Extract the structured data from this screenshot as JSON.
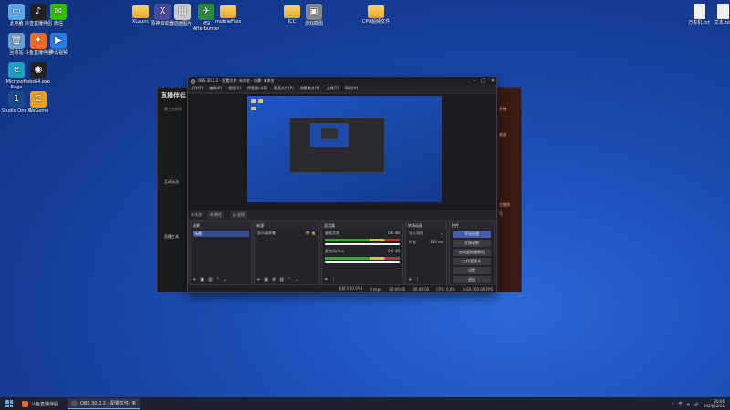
{
  "desktop_icons": [
    {
      "id": "i1",
      "label": "此电脑",
      "kind": "app",
      "color": "#5aa7e8",
      "glyph": "▭"
    },
    {
      "id": "i2",
      "label": "抖音直播伴侣",
      "kind": "app",
      "color": "#222",
      "glyph": "♪"
    },
    {
      "id": "i3",
      "label": "微信",
      "kind": "app",
      "color": "#2dc100",
      "glyph": "✉"
    },
    {
      "id": "i4",
      "label": "回收站",
      "kind": "app",
      "color": "#6aa0d0",
      "glyph": "🗑"
    },
    {
      "id": "i5",
      "label": "斗鱼直播伴侣",
      "kind": "app",
      "color": "#f26b1d",
      "glyph": "✦"
    },
    {
      "id": "i6",
      "label": "腾讯视频",
      "kind": "app",
      "color": "#2a7be4",
      "glyph": "▶"
    },
    {
      "id": "i7",
      "label": "Microsoft Edge",
      "kind": "app",
      "color": "#1fa0c4",
      "glyph": "e"
    },
    {
      "id": "i8",
      "label": "obs64.exe",
      "kind": "app",
      "color": "#222",
      "glyph": "◉"
    },
    {
      "id": "i9",
      "label": "Studio One 6",
      "kind": "app",
      "color": "#1a4a8a",
      "glyph": "1"
    },
    {
      "id": "i10",
      "label": "WeGame",
      "kind": "app",
      "color": "#e8a020",
      "glyph": "C"
    },
    {
      "id": "i11",
      "label": "XLaunc",
      "kind": "folder"
    },
    {
      "id": "i12",
      "label": "原神启动器",
      "kind": "app",
      "color": "#4a4a9a",
      "glyph": "X"
    },
    {
      "id": "i13",
      "label": "动画图片",
      "kind": "app",
      "color": "#ccc",
      "glyph": "▦"
    },
    {
      "id": "i14",
      "label": "MSI Afterburner",
      "kind": "app",
      "color": "#2a8a3a",
      "glyph": "✈"
    },
    {
      "id": "i15",
      "label": "mobileFiles",
      "kind": "folder"
    },
    {
      "id": "i16",
      "label": "ICC",
      "kind": "folder"
    },
    {
      "id": "i17",
      "label": "游戏截图",
      "kind": "app",
      "color": "#888",
      "glyph": "▣"
    },
    {
      "id": "i18",
      "label": "CPU超频文件",
      "kind": "folder"
    },
    {
      "id": "i19",
      "label": "万象机.txt",
      "kind": "file"
    },
    {
      "id": "i20",
      "label": "文本.txt",
      "kind": "file"
    }
  ],
  "bg_app": {
    "logo": "直播伴侣",
    "lines": [
      "第三方应用",
      "",
      "",
      "",
      "",
      "",
      ""
    ],
    "section1": "互动玩法",
    "section2": "直播工具",
    "right_labels": [
      "开播",
      "收益",
      "主播排",
      "号"
    ]
  },
  "obs": {
    "title": "OBS 30.2.2 - 配置文件: 未命名 - 场景: 未命名",
    "menus": [
      "文件(F)",
      "编辑(E)",
      "视图(V)",
      "停靠窗口(D)",
      "配置文件(P)",
      "场景集合(S)",
      "工具(T)",
      "帮助(H)"
    ],
    "toolbar": {
      "source": "未选源",
      "properties": "⚙ 属性",
      "filters": "▤ 滤镜"
    },
    "docks": {
      "scenes": {
        "title": "场景",
        "selected": "场景"
      },
      "sources": {
        "title": "来源",
        "item": "显示器采集"
      },
      "mixer": {
        "title": "混音器",
        "ch1": "桌面音频",
        "ch1_db": "0.0 dB",
        "ch2": "麦克风/Aux",
        "ch2_db": "0.0 dB"
      },
      "transitions": {
        "title": "转场动画",
        "type": "淡入淡出",
        "duration_label": "时长",
        "duration": "300 ms"
      },
      "controls": {
        "title": "控件",
        "buttons": [
          "开始直播",
          "开始录制",
          "启动虚拟摄像机",
          "工作室模式",
          "设置",
          "退出"
        ]
      }
    },
    "status": [
      "丢帧 0 (0.0%)",
      "0 kbps",
      "00:00:00",
      "00:00:00",
      "CPU: 0.0%",
      "0.00 / 60.00 FPS"
    ]
  },
  "taskbar": {
    "tasks": [
      {
        "label": "斗鱼直播伴侣",
        "color": "#f26b1d"
      },
      {
        "label": "OBS 30.2.2 - 配置文件: 未",
        "color": "#555"
      }
    ],
    "tray_lang": "中",
    "time": "20:06",
    "date": "2024/12/31"
  }
}
